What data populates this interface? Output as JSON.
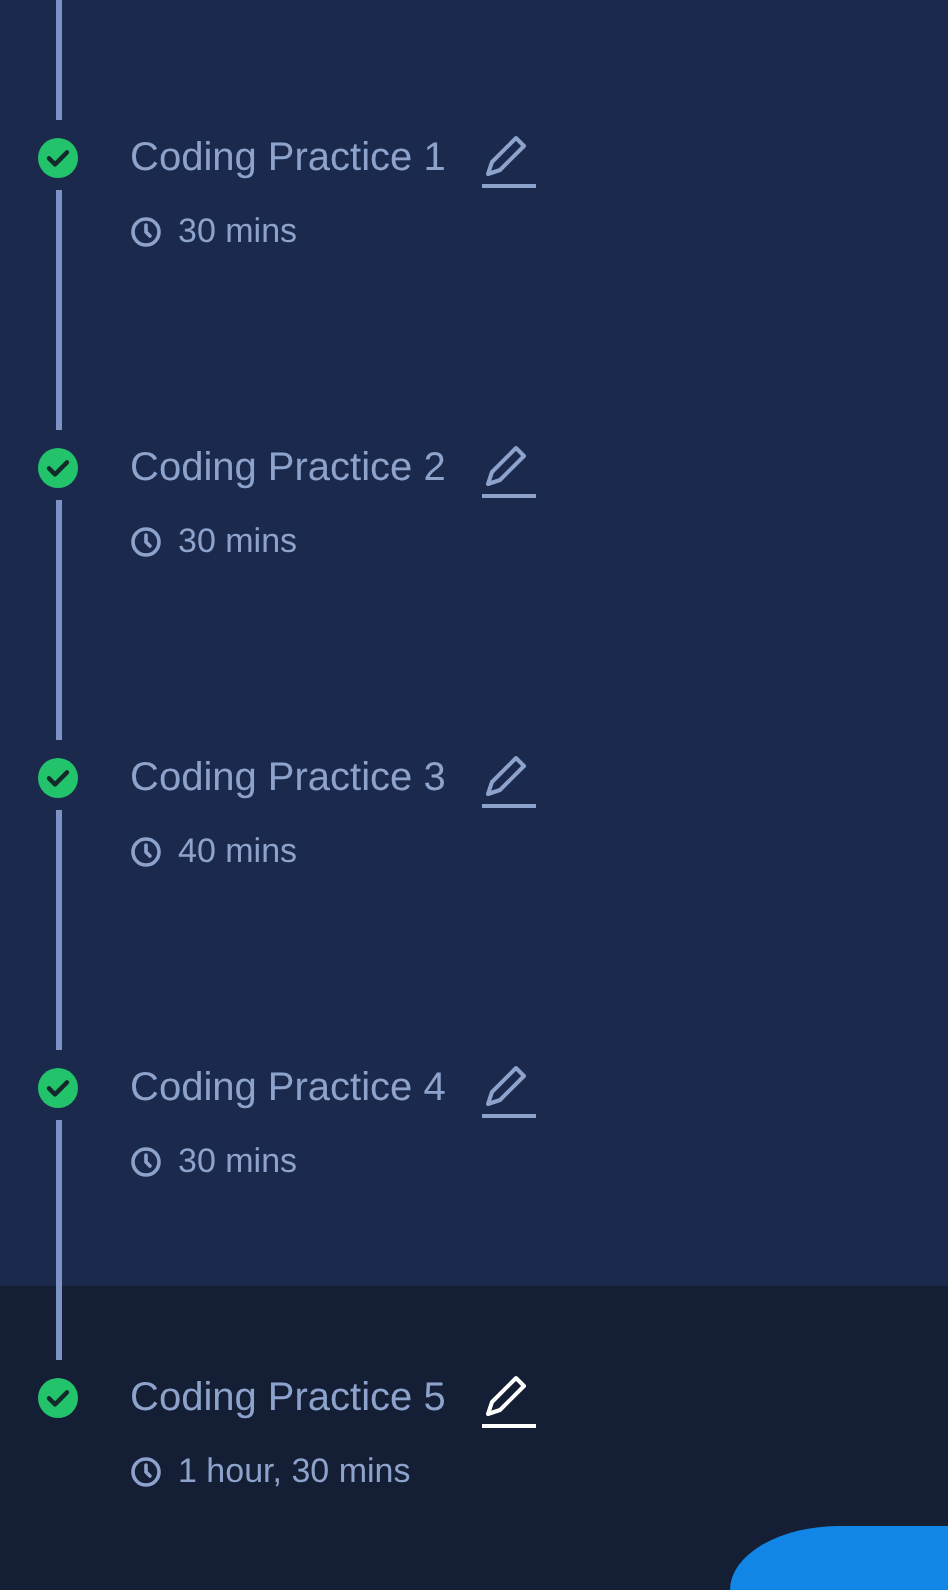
{
  "tasks": [
    {
      "title": "Coding Practice 1",
      "duration": "30 mins",
      "completed": true,
      "selected": false
    },
    {
      "title": "Coding Practice 2",
      "duration": "30 mins",
      "completed": true,
      "selected": false
    },
    {
      "title": "Coding Practice 3",
      "duration": "40 mins",
      "completed": true,
      "selected": false
    },
    {
      "title": "Coding Practice 4",
      "duration": "30 mins",
      "completed": true,
      "selected": false
    },
    {
      "title": "Coding Practice 5",
      "duration": "1 hour, 30 mins",
      "completed": true,
      "selected": true
    }
  ]
}
